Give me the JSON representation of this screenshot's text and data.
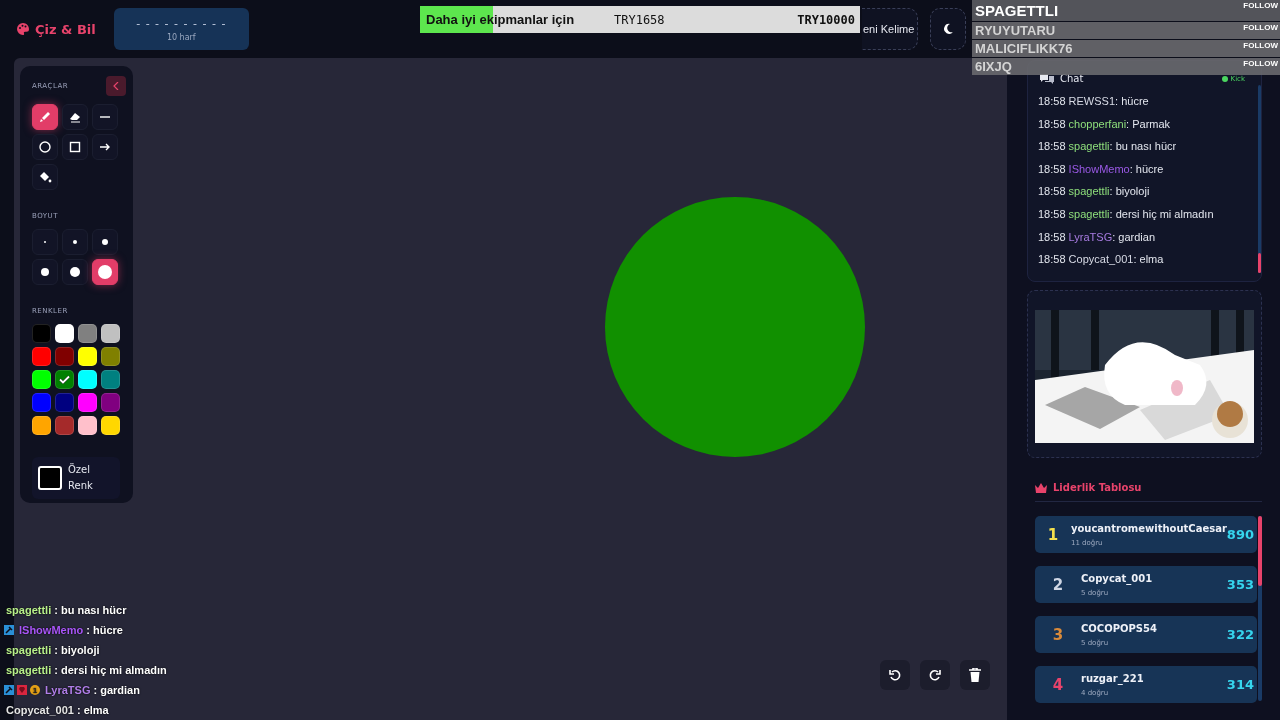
{
  "header": {
    "logo": "Çiz & Bil",
    "word_hint": "- - - - - - - - - -",
    "letter_count": "10 harf",
    "new_word_button": "eni Kelime"
  },
  "goal": {
    "label": "Daha iyi ekipmanlar için",
    "current": "TRY1658",
    "target": "TRY10000",
    "level": 0.166
  },
  "followers": [
    {
      "name": "SPAGETTLI",
      "action": "FOLLOW"
    },
    {
      "name": "RYUYUTARU",
      "action": "FOLLOW"
    },
    {
      "name": "MALICIFLIKK76",
      "action": "FOLLOW"
    },
    {
      "name": "6IXJQ",
      "action": "FOLLOW"
    }
  ],
  "tools": {
    "title": "ARAÇLAR",
    "items": [
      {
        "kind": "brush",
        "selected": true
      },
      {
        "kind": "eraser",
        "selected": false
      },
      {
        "kind": "line",
        "selected": false
      },
      {
        "kind": "circle",
        "selected": false
      },
      {
        "kind": "square",
        "selected": false
      },
      {
        "kind": "arrow",
        "selected": false
      },
      {
        "kind": "fill",
        "selected": false
      }
    ],
    "size_title": "BOYUT",
    "sizes": [
      {
        "kind": "xs",
        "selected": false
      },
      {
        "kind": "s",
        "selected": false
      },
      {
        "kind": "m",
        "selected": false
      },
      {
        "kind": "l",
        "selected": false
      },
      {
        "kind": "xl",
        "selected": false
      },
      {
        "kind": "xxl",
        "selected": true
      }
    ],
    "color_title": "RENKLER",
    "colors": [
      {
        "color": "#000000",
        "selected": false
      },
      {
        "color": "#ffffff",
        "selected": false
      },
      {
        "color": "#808080",
        "selected": false
      },
      {
        "color": "#c0c0c0",
        "selected": false
      },
      {
        "color": "#ff0000",
        "selected": false
      },
      {
        "color": "#800000",
        "selected": false
      },
      {
        "color": "#ffff00",
        "selected": false
      },
      {
        "color": "#808000",
        "selected": false
      },
      {
        "color": "#00ff00",
        "selected": false
      },
      {
        "color": "#008000",
        "selected": true
      },
      {
        "color": "#00ffff",
        "selected": false
      },
      {
        "color": "#008080",
        "selected": false
      },
      {
        "color": "#0000ff",
        "selected": false
      },
      {
        "color": "#000080",
        "selected": false
      },
      {
        "color": "#ff00ff",
        "selected": false
      },
      {
        "color": "#800080",
        "selected": false
      },
      {
        "color": "#ffa500",
        "selected": false
      },
      {
        "color": "#a52a2a",
        "selected": false
      },
      {
        "color": "#ffc0cb",
        "selected": false
      },
      {
        "color": "#ffd700",
        "selected": false
      }
    ],
    "custom_color": "Özel Renk"
  },
  "chat": {
    "title": "Chat",
    "source": "Kick",
    "messages": [
      {
        "time": "18:58",
        "user": "REWSS1",
        "color": "#d8dbe6",
        "text": ": hücre"
      },
      {
        "time": "18:58",
        "user": "chopperfani",
        "color": "#8fe07c",
        "text": ": Parmak"
      },
      {
        "time": "18:58",
        "user": "spagettli",
        "color": "#8fe07c",
        "text": ": bu nası hücr"
      },
      {
        "time": "18:58",
        "user": "IShowMemo",
        "color": "#9b59e6",
        "text": ": hücre"
      },
      {
        "time": "18:58",
        "user": "spagettli",
        "color": "#8fe07c",
        "text": ": biyoloji"
      },
      {
        "time": "18:58",
        "user": "spagettli",
        "color": "#8fe07c",
        "text": ": dersi hiç mi almadın"
      },
      {
        "time": "18:58",
        "user": "LyraTSG",
        "color": "#a77be0",
        "text": ": gardian"
      },
      {
        "time": "18:58",
        "user": "Copycat_001",
        "color": "#d8dbe6",
        "text": ": elma"
      }
    ]
  },
  "leaderboard": {
    "title": "Liderlik Tablosu",
    "rows": [
      {
        "rank": "1",
        "color": "#f4e04d",
        "name": "youcantromewithoutCaesar",
        "correct": "11 doğru",
        "score": "890"
      },
      {
        "rank": "2",
        "color": "#cfd6e4",
        "name": "Copycat_001",
        "correct": "5 doğru",
        "score": "353"
      },
      {
        "rank": "3",
        "color": "#d98a3a",
        "name": "COCOPOPS54",
        "correct": "5 doğru",
        "score": "322"
      },
      {
        "rank": "4",
        "color": "#e8436b",
        "name": "ruzgar_221",
        "correct": "4 doğru",
        "score": "314"
      }
    ]
  },
  "stream_chat": [
    {
      "user": "spagettli",
      "color": "#b8f08a",
      "text": ": bu nası hücr"
    },
    {
      "user": "IShowMemo",
      "color": "#a855f7",
      "badges": [
        {
          "kind": "mod"
        }
      ],
      "text": ": hücre"
    },
    {
      "user": "spagettli",
      "color": "#b8f08a",
      "text": ": biyoloji"
    },
    {
      "user": "spagettli",
      "color": "#b8f08a",
      "text": ": dersi hiç mi almadın"
    },
    {
      "user": "LyraTSG",
      "color": "#b07ee8",
      "badges": [
        {
          "kind": "mod"
        },
        {
          "kind": "vip"
        },
        {
          "kind": "count",
          "label": "1"
        }
      ],
      "text": ": gardian"
    },
    {
      "user": "Copycat_001",
      "color": "#e6e6e6",
      "text": ": elma"
    }
  ]
}
